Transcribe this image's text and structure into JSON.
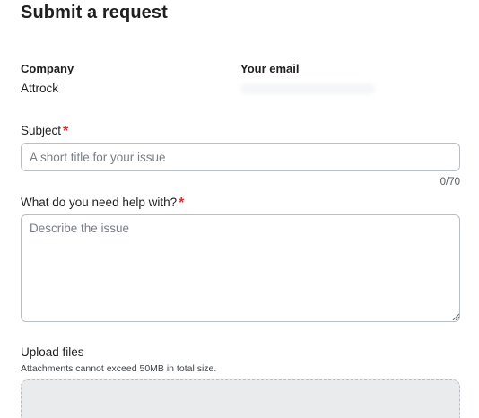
{
  "page": {
    "title": "Submit a request"
  },
  "info": {
    "company_label": "Company",
    "company_value": "Attrock",
    "email_label": "Your email"
  },
  "subject": {
    "label": "Subject",
    "required_mark": "*",
    "placeholder": "A short title for your issue",
    "counter": "0/70"
  },
  "help": {
    "label": "What do you need help with?",
    "required_mark": "*",
    "placeholder": "Describe the issue"
  },
  "upload": {
    "label": "Upload files",
    "hint": "Attachments cannot exceed 50MB in total size."
  },
  "colors": {
    "required": "#c33b3b",
    "border": "#b9bec3",
    "dropzone_bg": "#e9ebed"
  }
}
